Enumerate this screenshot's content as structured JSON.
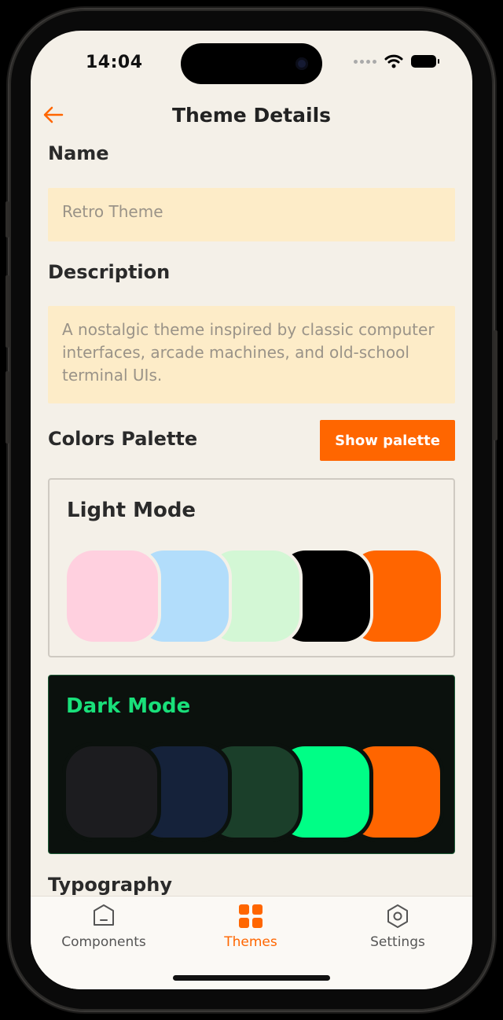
{
  "status_bar": {
    "time": "14:04"
  },
  "header": {
    "title": "Theme Details"
  },
  "name": {
    "label": "Name",
    "value": "Retro Theme"
  },
  "description": {
    "label": "Description",
    "value": "A nostalgic theme inspired by classic computer interfaces, arcade machines, and old-school terminal UIs."
  },
  "palette": {
    "label": "Colors Palette",
    "button_label": "Show palette",
    "light_mode": {
      "title": "Light Mode",
      "title_color": "#2a2a2a",
      "colors": [
        "#ffd0df",
        "#b2ddfb",
        "#d3f7d5",
        "#000000",
        "#ff6500"
      ]
    },
    "dark_mode": {
      "title": "Dark Mode",
      "title_color": "#19e07a",
      "colors": [
        "#1c1c1f",
        "#15223a",
        "#1b3f2a",
        "#00fe86",
        "#ff6500"
      ]
    }
  },
  "typography": {
    "label": "Typography"
  },
  "tab_bar": {
    "tabs": [
      {
        "label": "Components",
        "icon": "components-icon",
        "active": false
      },
      {
        "label": "Themes",
        "icon": "themes-grid-icon",
        "active": true
      },
      {
        "label": "Settings",
        "icon": "settings-hex-icon",
        "active": false
      }
    ]
  },
  "colors": {
    "accent": "#ff6600",
    "background": "#f4f0e8",
    "input_background": "#fdecc8"
  }
}
